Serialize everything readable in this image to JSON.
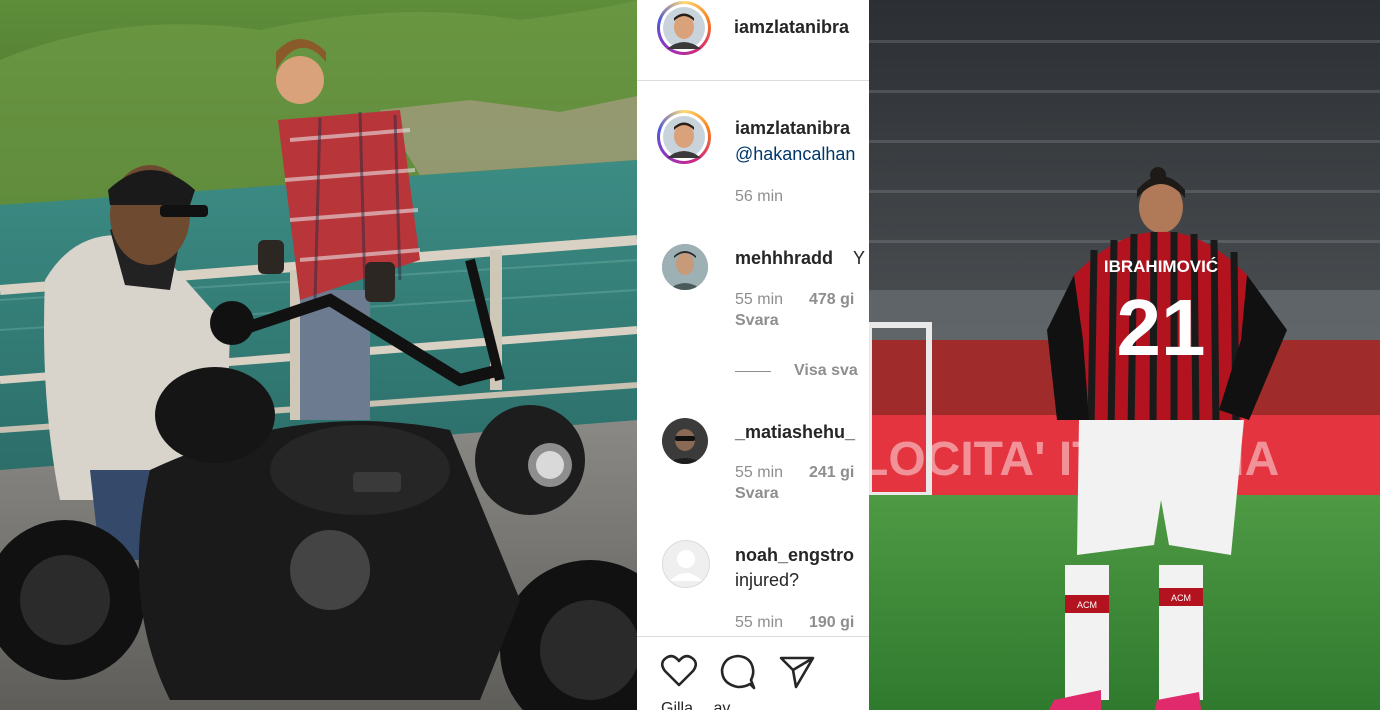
{
  "post": {
    "header_username": "iamzlatanibra",
    "caption_username": "iamzlatanibra",
    "caption_mention": "@hakancalhan",
    "caption_time": "56 min"
  },
  "comments": [
    {
      "username": "mehhhradd",
      "text_fragment": "Y",
      "time": "55 min",
      "likes": "478 gi",
      "reply_label": "Svara"
    },
    {
      "username": "_matiashehu_",
      "time": "55 min",
      "likes": "241 gi",
      "reply_label": "Svara"
    },
    {
      "username": "noah_engstro",
      "text": "injured?",
      "time": "55 min",
      "likes": "190 gi"
    }
  ],
  "view_replies_label": "Visa sva",
  "actions": {
    "like_icon": "heart-icon",
    "comment_icon": "comment-icon",
    "share_icon": "paper-plane-icon"
  },
  "footer_partial": "Gilla… av …",
  "right_photo": {
    "jersey_name": "IBRAHIMOVIĆ",
    "jersey_number": "21",
    "ad_board_text": "LOCITA' ITALIANA",
    "sock_label_left": "ACM",
    "sock_label_right": "ACM"
  },
  "colors": {
    "instagram_text": "#262626",
    "instagram_meta": "#8e8e8e",
    "mention_blue": "#00376b",
    "milan_red": "#c8102e",
    "pitch_green": "#3f8f3a"
  }
}
